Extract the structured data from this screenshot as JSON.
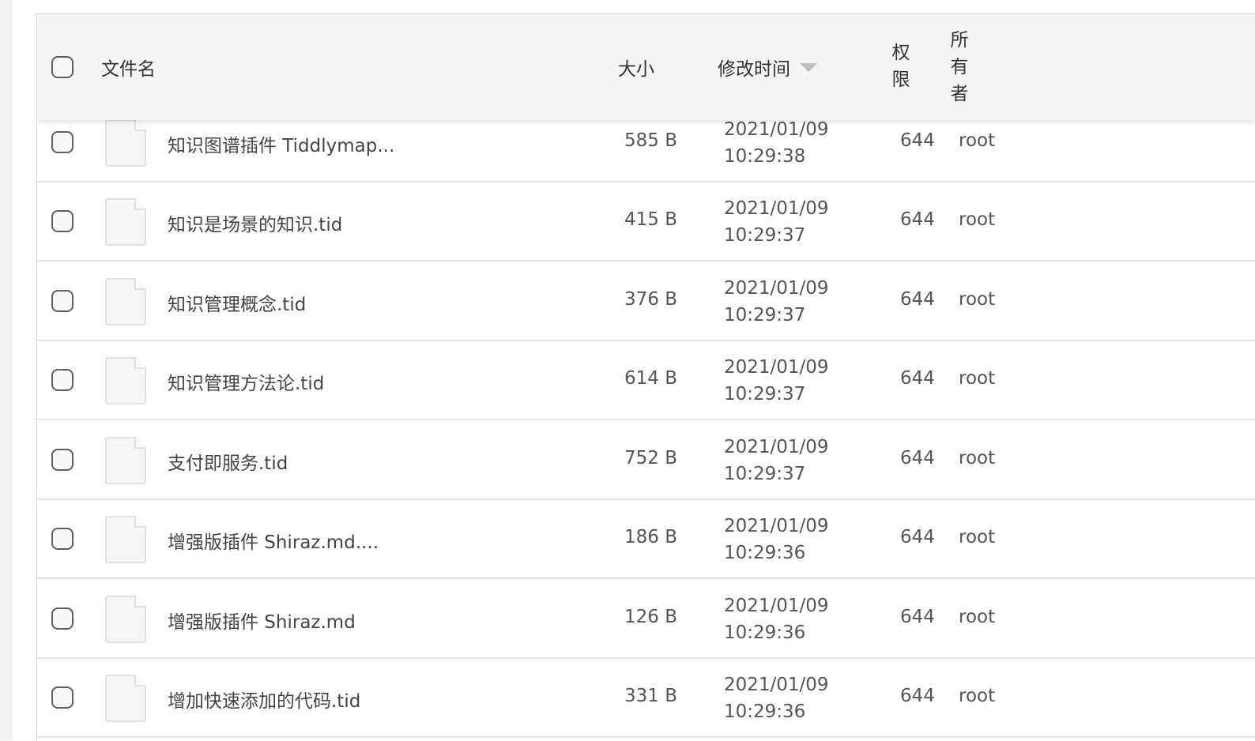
{
  "header": {
    "name": "文件名",
    "size": "大小",
    "mtime": "修改时间",
    "perm": "权限",
    "owner": "所有者"
  },
  "rows": [
    {
      "name": "知识图谱插件 Tiddlymap...",
      "size": "585 B",
      "date": "2021/01/09",
      "time": "10:29:38",
      "perm": "644",
      "owner": "root"
    },
    {
      "name": "知识是场景的知识.tid",
      "size": "415 B",
      "date": "2021/01/09",
      "time": "10:29:37",
      "perm": "644",
      "owner": "root"
    },
    {
      "name": "知识管理概念.tid",
      "size": "376 B",
      "date": "2021/01/09",
      "time": "10:29:37",
      "perm": "644",
      "owner": "root"
    },
    {
      "name": "知识管理方法论.tid",
      "size": "614 B",
      "date": "2021/01/09",
      "time": "10:29:37",
      "perm": "644",
      "owner": "root"
    },
    {
      "name": "支付即服务.tid",
      "size": "752 B",
      "date": "2021/01/09",
      "time": "10:29:37",
      "perm": "644",
      "owner": "root"
    },
    {
      "name": "增强版插件 Shiraz.md....",
      "size": "186 B",
      "date": "2021/01/09",
      "time": "10:29:36",
      "perm": "644",
      "owner": "root"
    },
    {
      "name": "增强版插件 Shiraz.md",
      "size": "126 B",
      "date": "2021/01/09",
      "time": "10:29:36",
      "perm": "644",
      "owner": "root"
    },
    {
      "name": "增加快速添加的代码.tid",
      "size": "331 B",
      "date": "2021/01/09",
      "time": "10:29:36",
      "perm": "644",
      "owner": "root"
    }
  ]
}
